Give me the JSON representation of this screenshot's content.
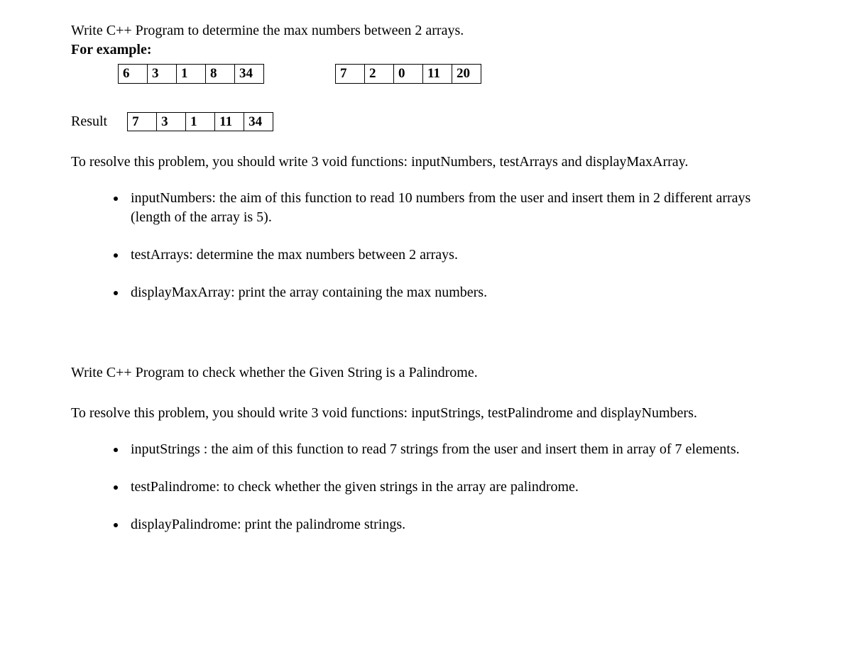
{
  "problem1": {
    "title": "Write C++ Program to determine the max numbers between 2 arrays.",
    "for_example": "For example:",
    "array1": [
      "6",
      "3",
      "1",
      "8",
      "34"
    ],
    "array2": [
      "7",
      "2",
      "0",
      "11",
      "20"
    ],
    "result_label": "Result",
    "result_array": [
      "7",
      "3",
      "1",
      "11",
      "34"
    ],
    "resolve": "To resolve this problem, you should write 3 void functions: inputNumbers, testArrays and displayMaxArray.",
    "bullets": [
      "inputNumbers: the aim of this function to read 10 numbers from the user and insert them in 2 different arrays (length of the array is 5).",
      "testArrays: determine the max numbers between 2 arrays.",
      "displayMaxArray: print the array containing the max numbers."
    ]
  },
  "problem2": {
    "title": "Write C++ Program to check whether the Given String is a Palindrome.",
    "resolve": "To resolve this problem, you should write 3 void functions: inputStrings, testPalindrome and displayNumbers.",
    "bullets": [
      "inputStrings : the aim of this function to read 7 strings from the user and insert them in array of 7 elements.",
      "testPalindrome: to check whether the given strings in the array are palindrome.",
      "displayPalindrome: print the palindrome strings."
    ]
  }
}
